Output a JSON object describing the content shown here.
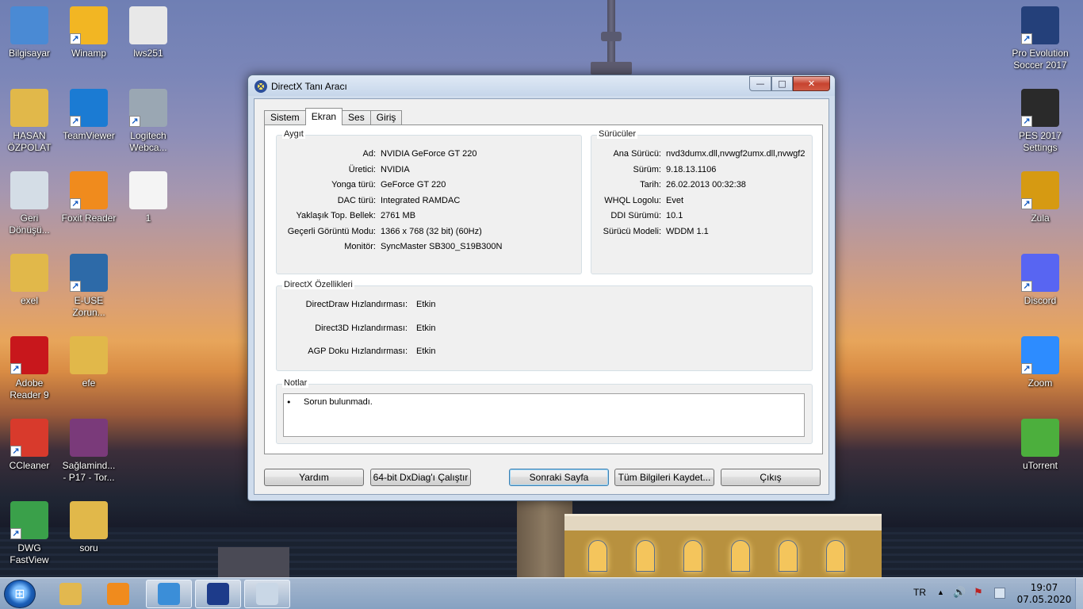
{
  "desktop": {
    "icons_left": [
      {
        "name": "bilgisayar",
        "label": "Bilgisayar",
        "color": "#4a8ad4",
        "shortcut": false
      },
      {
        "name": "winamp",
        "label": "Winamp",
        "color": "#f2b623",
        "shortcut": true
      },
      {
        "name": "lws251",
        "label": "lws251",
        "color": "#e8e8e8",
        "shortcut": false
      },
      {
        "name": "hasan-ozpolat",
        "label": "HASAN\nÖZPOLAT",
        "color": "#e1b84a",
        "shortcut": false
      },
      {
        "name": "teamviewer",
        "label": "TeamViewer",
        "color": "#1b7bd3",
        "shortcut": true
      },
      {
        "name": "logitech-webcam",
        "label": "Logitech\nWebca...",
        "color": "#9aa7b3",
        "shortcut": true
      },
      {
        "name": "geri-donusum",
        "label": "Geri\nDönüşü...",
        "color": "#d4dde6",
        "shortcut": false
      },
      {
        "name": "foxit-reader",
        "label": "Foxit Reader",
        "color": "#f08b1d",
        "shortcut": true
      },
      {
        "name": "file-1",
        "label": "1",
        "color": "#f4f4f4",
        "shortcut": false
      },
      {
        "name": "exel",
        "label": "exel",
        "color": "#e1b84a",
        "shortcut": false
      },
      {
        "name": "e-use",
        "label": "E-USE\nZorun...",
        "color": "#2d6aa8",
        "shortcut": true
      },
      {
        "name": "adobe-reader",
        "label": "Adobe\nReader 9",
        "color": "#c8171c",
        "shortcut": true
      },
      {
        "name": "efe",
        "label": "efe",
        "color": "#e1b84a",
        "shortcut": false
      },
      {
        "name": "ccleaner",
        "label": "CCleaner",
        "color": "#d83a2c",
        "shortcut": true
      },
      {
        "name": "saglamind",
        "label": "Sağlamind...\n- P17 - Tor...",
        "color": "#7a3a7a",
        "shortcut": false
      },
      {
        "name": "dwg-fastview",
        "label": "DWG\nFastView",
        "color": "#3aa04a",
        "shortcut": true
      },
      {
        "name": "soru",
        "label": "soru",
        "color": "#e1b84a",
        "shortcut": false
      }
    ],
    "icons_right": [
      {
        "name": "pes-2017",
        "label": "Pro Evolution\nSoccer 2017",
        "color": "#24407a",
        "shortcut": true
      },
      {
        "name": "pes-2017-settings",
        "label": "PES 2017\nSettings",
        "color": "#2a2a2a",
        "shortcut": true
      },
      {
        "name": "zula",
        "label": "Zula",
        "color": "#d69a12",
        "shortcut": true
      },
      {
        "name": "discord",
        "label": "Discord",
        "color": "#5865f2",
        "shortcut": true
      },
      {
        "name": "zoom",
        "label": "Zoom",
        "color": "#2d8cff",
        "shortcut": true
      },
      {
        "name": "utorrent",
        "label": "uTorrent",
        "color": "#4caf3d",
        "shortcut": false
      }
    ]
  },
  "window": {
    "title": "DirectX Tanı Aracı",
    "controls": {
      "minimize": "—",
      "maximize": "□",
      "close": "✕"
    },
    "tabs": [
      {
        "label": "Sistem",
        "active": false
      },
      {
        "label": "Ekran",
        "active": true
      },
      {
        "label": "Ses",
        "active": false
      },
      {
        "label": "Giriş",
        "active": false
      }
    ],
    "device": {
      "title": "Aygıt",
      "rows": [
        {
          "k": "Ad:",
          "v": "NVIDIA GeForce GT 220"
        },
        {
          "k": "Üretici:",
          "v": "NVIDIA"
        },
        {
          "k": "Yonga türü:",
          "v": "GeForce GT 220"
        },
        {
          "k": "DAC türü:",
          "v": "Integrated RAMDAC"
        },
        {
          "k": "Yaklaşık Top. Bellek:",
          "v": "2761 MB"
        },
        {
          "k": "Geçerli Görüntü Modu:",
          "v": "1366 x 768 (32 bit) (60Hz)"
        },
        {
          "k": "Monitör:",
          "v": "SyncMaster SB300_S19B300N"
        }
      ]
    },
    "drivers": {
      "title": "Sürücüler",
      "rows": [
        {
          "k": "Ana Sürücü:",
          "v": "nvd3dumx.dll,nvwgf2umx.dll,nvwgf2"
        },
        {
          "k": "Sürüm:",
          "v": "9.18.13.1106"
        },
        {
          "k": "Tarih:",
          "v": "26.02.2013 00:32:38"
        },
        {
          "k": "WHQL Logolu:",
          "v": "Evet"
        },
        {
          "k": "DDI Sürümü:",
          "v": "10.1"
        },
        {
          "k": "Sürücü Modeli:",
          "v": "WDDM 1.1"
        }
      ]
    },
    "features": {
      "title": "DirectX Özellikleri",
      "rows": [
        {
          "k": "DirectDraw Hızlandırması:",
          "v": "Etkin"
        },
        {
          "k": "Direct3D Hızlandırması:",
          "v": "Etkin"
        },
        {
          "k": "AGP Doku Hızlandırması:",
          "v": "Etkin"
        }
      ]
    },
    "notes": {
      "title": "Notlar",
      "bullet": "•",
      "text": "Sorun bulunmadı."
    },
    "buttons": {
      "help": "Yardım",
      "run64": "64-bit DxDiag'ı Çalıştır",
      "next": "Sonraki Sayfa",
      "save": "Tüm Bilgileri Kaydet...",
      "exit": "Çıkış"
    }
  },
  "taskbar": {
    "start_glyph": "⊞",
    "items": [
      {
        "name": "explorer",
        "color": "#e2b84f",
        "open": false
      },
      {
        "name": "media-player",
        "color": "#f08b1d",
        "open": false
      },
      {
        "name": "chrome",
        "color": "#3b8ed8",
        "open": true
      },
      {
        "name": "directx",
        "color": "#1d3b8a",
        "open": true
      },
      {
        "name": "paint",
        "color": "#c9d7e6",
        "open": true
      }
    ],
    "language": "TR",
    "tray_up": "▲",
    "volume": "🔊",
    "network": "⚑",
    "time": "19:07",
    "date": "07.05.2020"
  }
}
